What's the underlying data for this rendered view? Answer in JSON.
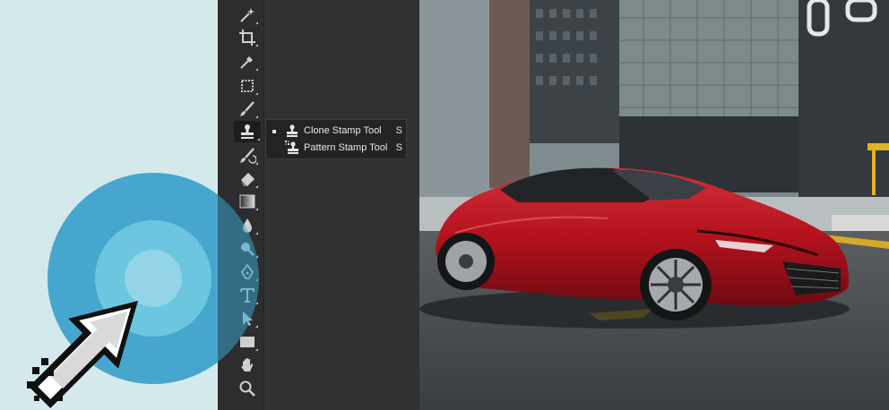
{
  "flyout": {
    "items": [
      {
        "label": "Clone Stamp Tool",
        "shortcut": "S",
        "selected": true
      },
      {
        "label": "Pattern Stamp Tool",
        "shortcut": "S",
        "selected": false
      }
    ]
  },
  "toolbar": {
    "tools": [
      "magic-wand-icon",
      "crop-icon",
      "eyedropper-icon",
      "spot-healing-icon",
      "brush-icon",
      "clone-stamp-icon",
      "history-brush-icon",
      "eraser-icon",
      "gradient-icon",
      "blur-icon",
      "dodge-icon",
      "pen-icon",
      "type-icon",
      "path-selection-icon",
      "rectangle-icon",
      "hand-icon",
      "zoom-icon"
    ],
    "active_tool": "clone-stamp-icon"
  },
  "colors": {
    "toolbar_bg": "#2b2d2f",
    "workspace_bg": "#2f3133",
    "flyout_bg": "#222325",
    "left_bg": "#d4e9ec",
    "ring_outer": "#3aa0ca",
    "car_red": "#b3121d"
  }
}
